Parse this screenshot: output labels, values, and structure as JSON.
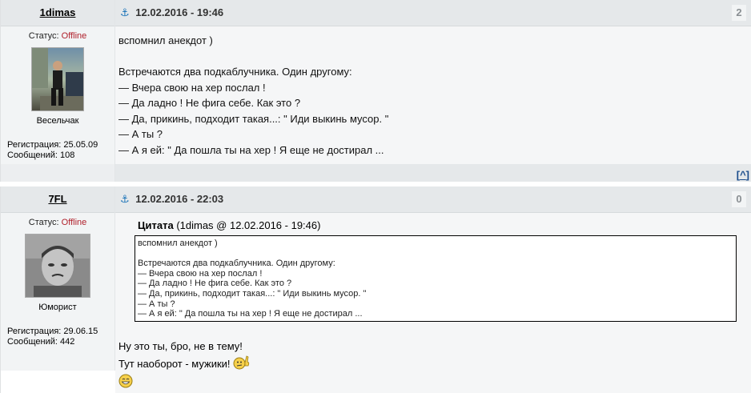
{
  "posts": [
    {
      "author": "1dimas",
      "status_label": "Статус:",
      "status_value": "Offline",
      "rank": "Весельчак",
      "reg_label": "Регистрация:",
      "reg_date": "25.05.09",
      "msgs_label": "Сообщений:",
      "msgs_count": "108",
      "datetime": "12.02.2016 - 19:46",
      "number": "2",
      "body": [
        "вспомнил анекдот )",
        "",
        "Встречаются два подкаблучника. Один другому:",
        "— Вчера свою на хер послал !",
        "— Да ладно ! Не фига себе. Как это ?",
        "— Да, прикинь, подходит такая...: \" Иди выкинь мусор. \"",
        "— А ты ?",
        "— А я ей: \" Да пошла ты на хер ! Я еще не достирал ..."
      ]
    },
    {
      "author": "7FL",
      "status_label": "Статус:",
      "status_value": "Offline",
      "rank": "Юморист",
      "reg_label": "Регистрация:",
      "reg_date": "29.06.15",
      "msgs_label": "Сообщений:",
      "msgs_count": "442",
      "datetime": "12.02.2016 - 22:03",
      "number": "0",
      "quote": {
        "label": "Цитата",
        "source": "(1dimas @ 12.02.2016 - 19:46)",
        "lines": [
          "вспомнил анекдот )",
          "",
          "Встречаются два подкаблучника. Один другому:",
          "— Вчера свою на хер послал !",
          "— Да ладно ! Не фига себе. Как это ?",
          "— Да, прикинь, подходит такая...: \" Иди выкинь мусор. \"",
          "— А ты ?",
          "— А я ей: \" Да пошла ты на хер ! Я еще не достирал ..."
        ]
      },
      "reply_line1": "Ну это ты, бро, не в тему!",
      "reply_line2": "Тут наоборот - мужики!"
    }
  ],
  "top_link": "[^]",
  "top_link_inner": "^",
  "top_link_open": "[",
  "top_link_close": "]",
  "icons": {
    "anchor": "anchor-icon",
    "smiley_pointing": "smiley-pointing-icon",
    "smiley_grin": "smiley-grin-icon"
  }
}
